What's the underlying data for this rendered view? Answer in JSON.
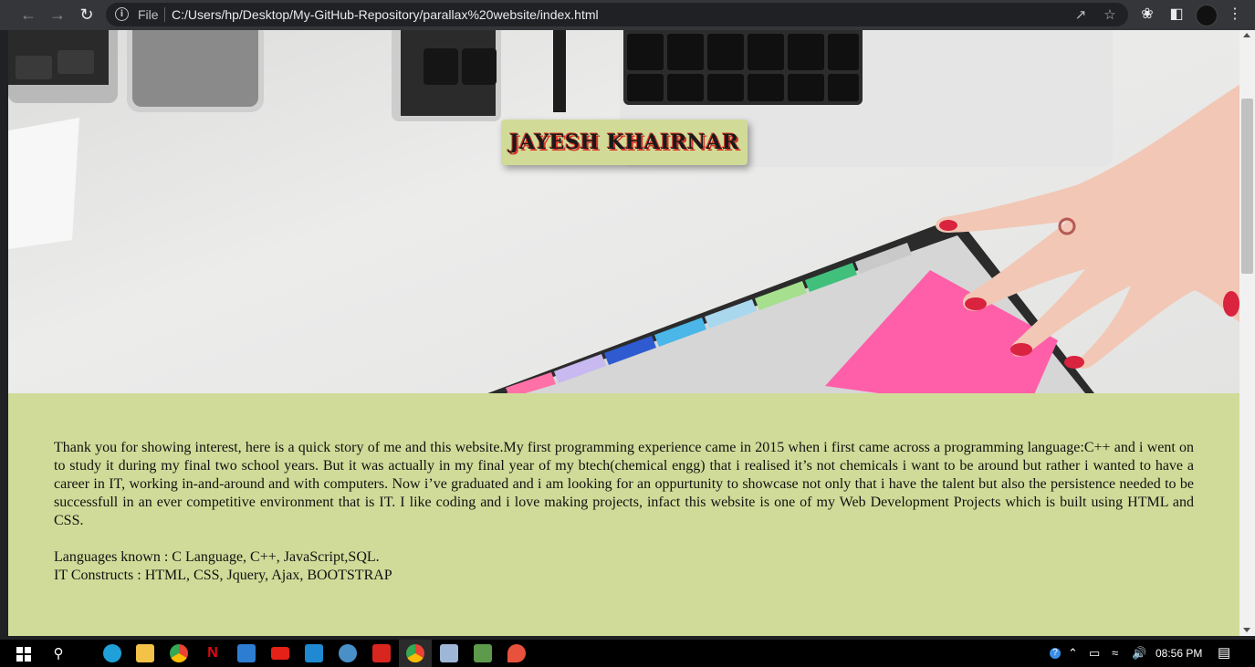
{
  "browser": {
    "scheme_label": "File",
    "url": "C:/Users/hp/Desktop/My-GitHub-Repository/parallax%20website/index.html",
    "icons": [
      "back-arrow-icon",
      "forward-arrow-icon",
      "reload-icon",
      "info-icon",
      "share-icon",
      "star-icon",
      "extensions-icon",
      "sidebar-icon",
      "profile-avatar",
      "more-icon"
    ]
  },
  "page": {
    "hero_title": "JAYESH KHAIRNAR",
    "story": "Thank you for showing interest, here is a quick story of me and this website.My first programming experience came in 2015 when i first came across a programming language:C++ and i went on to study it during my final two school years. But it was actually in my final year of my btech(chemical engg) that i realised it’s not chemicals i want to be around but rather i wanted to have a career in IT, working in-and-around and with computers. Now i’ve graduated and i am looking for an oppurtunity to showcase not only that i have the talent but also the persistence needed to be successfull in an ever competitive environment that is IT. I like coding and i love making projects, infact this website is one of my Web Development Projects which is built using HTML and CSS.",
    "languages": "Languages known : C Language, C++, JavaScript,SQL.",
    "constructs": "IT Constructs : HTML, CSS, Jquery, Ajax, BOOTSTRAP",
    "colors": {
      "content_bg": "#d1db99",
      "name_card_bg": "#d1db97",
      "name_shadow": "#d9362a"
    }
  },
  "taskbar": {
    "time": "08:56 PM",
    "apps": [
      "start-icon",
      "search-icon",
      "edge-icon",
      "file-explorer-icon",
      "chrome-icon",
      "netflix-icon",
      "store-icon",
      "youtube-icon",
      "vscode-icon",
      "app-icon",
      "acrobat-icon",
      "chrome-active-icon",
      "notepad-icon",
      "git-icon",
      "app2-icon"
    ]
  }
}
